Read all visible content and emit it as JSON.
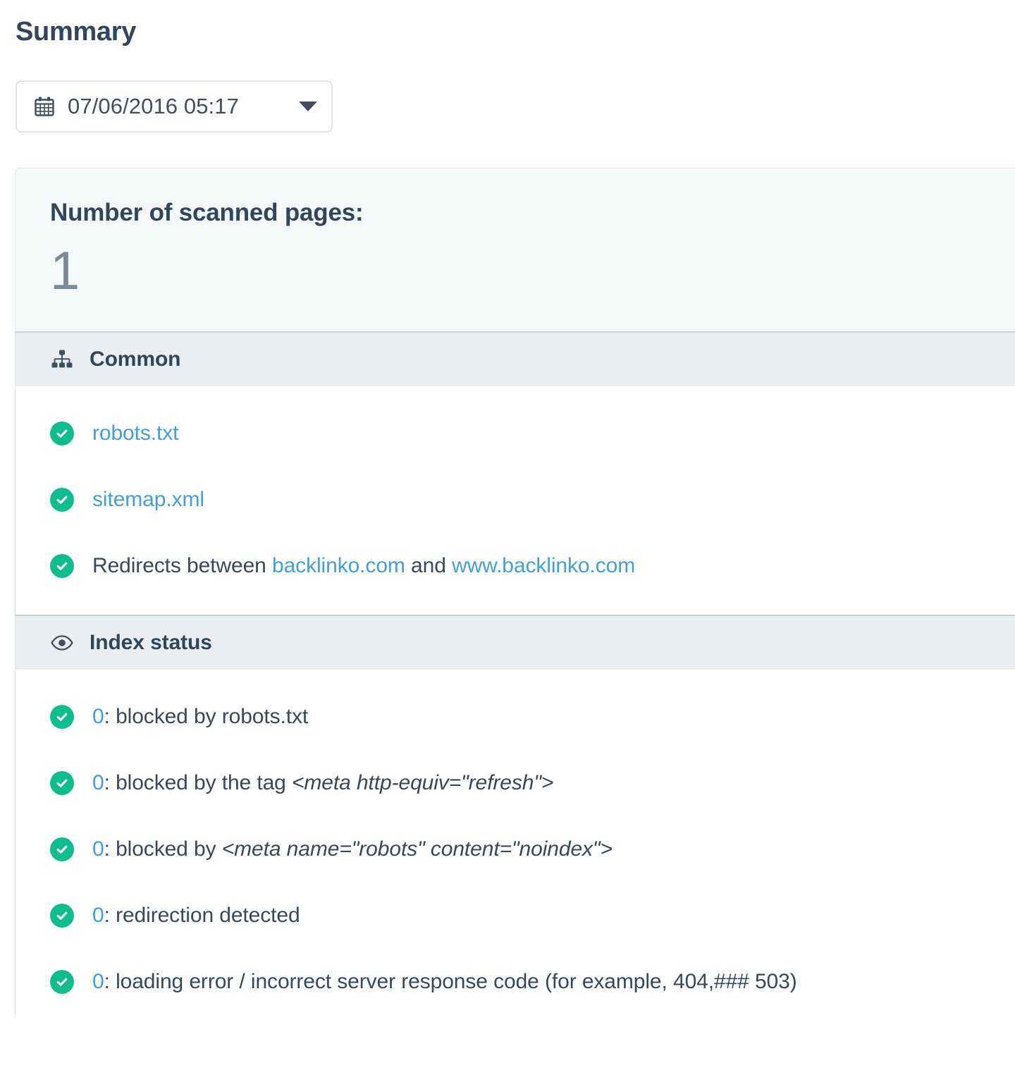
{
  "page": {
    "title": "Summary"
  },
  "datepicker": {
    "icon": "calendar-icon",
    "value": "07/06/2016 05:17",
    "caret": "caret-down-icon"
  },
  "summary": {
    "label": "Number of scanned pages:",
    "value": "1"
  },
  "sections": [
    {
      "id": "common",
      "icon": "sitemap-icon",
      "title": "Common",
      "rows": [
        {
          "status": "ok",
          "parts": [
            {
              "type": "link",
              "text": "robots.txt"
            }
          ]
        },
        {
          "status": "ok",
          "parts": [
            {
              "type": "link",
              "text": "sitemap.xml"
            }
          ]
        },
        {
          "status": "ok",
          "parts": [
            {
              "type": "text",
              "text": "Redirects between "
            },
            {
              "type": "link",
              "text": "backlinko.com"
            },
            {
              "type": "text",
              "text": " and "
            },
            {
              "type": "link",
              "text": "www.backlinko.com"
            }
          ]
        }
      ]
    },
    {
      "id": "index-status",
      "icon": "eye-icon",
      "title": "Index status",
      "rows": [
        {
          "status": "ok",
          "parts": [
            {
              "type": "num",
              "text": "0"
            },
            {
              "type": "text",
              "text": ": blocked by robots.txt"
            }
          ]
        },
        {
          "status": "ok",
          "parts": [
            {
              "type": "num",
              "text": "0"
            },
            {
              "type": "text",
              "text": ": blocked by the tag "
            },
            {
              "type": "code",
              "text": "<meta http-equiv=\"refresh\">"
            }
          ]
        },
        {
          "status": "ok",
          "parts": [
            {
              "type": "num",
              "text": "0"
            },
            {
              "type": "text",
              "text": ": blocked by "
            },
            {
              "type": "code",
              "text": "<meta name=\"robots\" content=\"noindex\">"
            }
          ]
        },
        {
          "status": "ok",
          "parts": [
            {
              "type": "num",
              "text": "0"
            },
            {
              "type": "text",
              "text": ": redirection detected"
            }
          ]
        },
        {
          "status": "ok",
          "parts": [
            {
              "type": "num",
              "text": "0"
            },
            {
              "type": "text",
              "text": ": loading error / incorrect server response code (for example, 404,### 503)"
            }
          ]
        }
      ]
    }
  ],
  "colors": {
    "accent_link": "#3fa0e0",
    "status_ok": "#0fbd8c",
    "heading": "#31465c",
    "body_text": "#37485a",
    "panel_bg": "#f4f8f9",
    "section_header_bg": "#eaeef0",
    "big_number": "#7b8c99"
  }
}
